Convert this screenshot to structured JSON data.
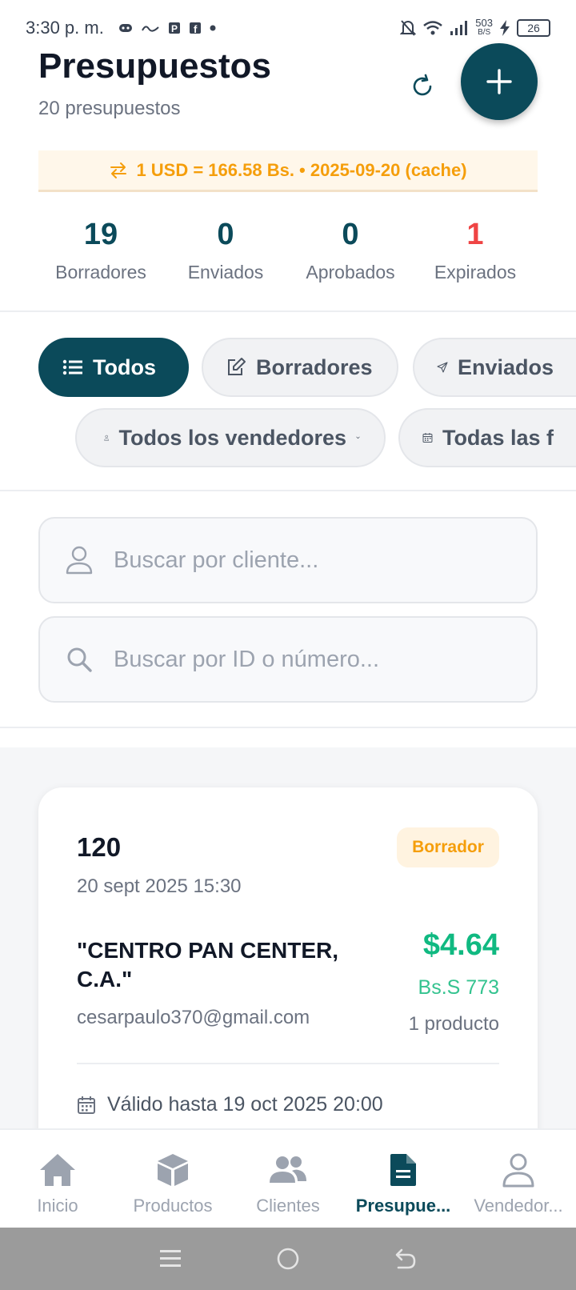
{
  "status_bar": {
    "time": "3:30 p. m.",
    "network_speed_value": "503",
    "network_speed_unit": "B/S",
    "battery": "26"
  },
  "header": {
    "title": "Presupuestos",
    "subtitle": "20 presupuestos"
  },
  "rate_banner": {
    "text": "1 USD = 166.58 Bs. • 2025-09-20 (cache)"
  },
  "stats": [
    {
      "value": "19",
      "label": "Borradores"
    },
    {
      "value": "0",
      "label": "Enviados"
    },
    {
      "value": "0",
      "label": "Aprobados"
    },
    {
      "value": "1",
      "label": "Expirados"
    }
  ],
  "status_filters": [
    {
      "label": "Todos",
      "icon": "list-icon",
      "active": true
    },
    {
      "label": "Borradores",
      "icon": "edit-icon",
      "active": false
    },
    {
      "label": "Enviados",
      "icon": "send-icon",
      "active": false
    }
  ],
  "seller_filter": {
    "label": "Todos los vendedores"
  },
  "date_filter": {
    "label": "Todas las f"
  },
  "search": {
    "client_placeholder": "Buscar por cliente...",
    "id_placeholder": "Buscar por ID o número..."
  },
  "quotes": [
    {
      "number": "120",
      "date": "20 sept 2025 15:30",
      "status": "Borrador",
      "client": "\"CENTRO PAN CENTER, C.A.\"",
      "email": "cesarpaulo370@gmail.com",
      "total_usd": "$4.64",
      "total_bs": "Bs.S 773",
      "products": "1 producto",
      "valid_until": "Válido hasta 19 oct 2025 20:00"
    }
  ],
  "bottom_nav": [
    {
      "label": "Inicio",
      "icon": "home-icon",
      "active": false
    },
    {
      "label": "Productos",
      "icon": "box-icon",
      "active": false
    },
    {
      "label": "Clientes",
      "icon": "users-icon",
      "active": false
    },
    {
      "label": "Presupue...",
      "icon": "document-icon",
      "active": true
    },
    {
      "label": "Vendedor...",
      "icon": "user-icon",
      "active": false
    }
  ],
  "colors": {
    "primary": "#0b4a5a",
    "warning": "#f59e0b",
    "success": "#10b981",
    "danger": "#ef4444"
  }
}
